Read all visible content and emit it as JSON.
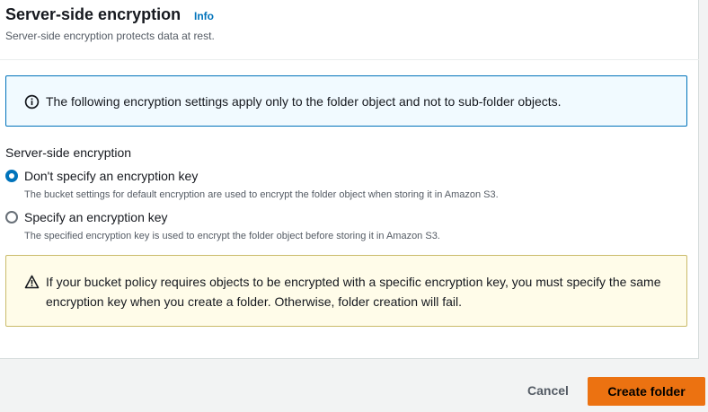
{
  "section": {
    "title": "Server-side encryption",
    "info_link": "Info",
    "subtitle": "Server-side encryption protects data at rest."
  },
  "info_alert": {
    "icon": "info-circle-icon",
    "message": "The following encryption settings apply only to the folder object and not to sub-folder objects."
  },
  "encryption": {
    "label": "Server-side encryption",
    "options": [
      {
        "label": "Don't specify an encryption key",
        "description": "The bucket settings for default encryption are used to encrypt the folder object when storing it in Amazon S3.",
        "selected": true
      },
      {
        "label": "Specify an encryption key",
        "description": "The specified encryption key is used to encrypt the folder object before storing it in Amazon S3.",
        "selected": false
      }
    ]
  },
  "warning_alert": {
    "icon": "warning-triangle-icon",
    "message": "If your bucket policy requires objects to be encrypted with a specific encryption key, you must specify the same encryption key when you create a folder. Otherwise, folder creation will fail."
  },
  "footer": {
    "cancel_label": "Cancel",
    "create_label": "Create folder"
  },
  "colors": {
    "primary_button": "#ec7211",
    "link": "#0073bb",
    "info_border": "#0073bb",
    "warning_border": "#cabb6b"
  }
}
